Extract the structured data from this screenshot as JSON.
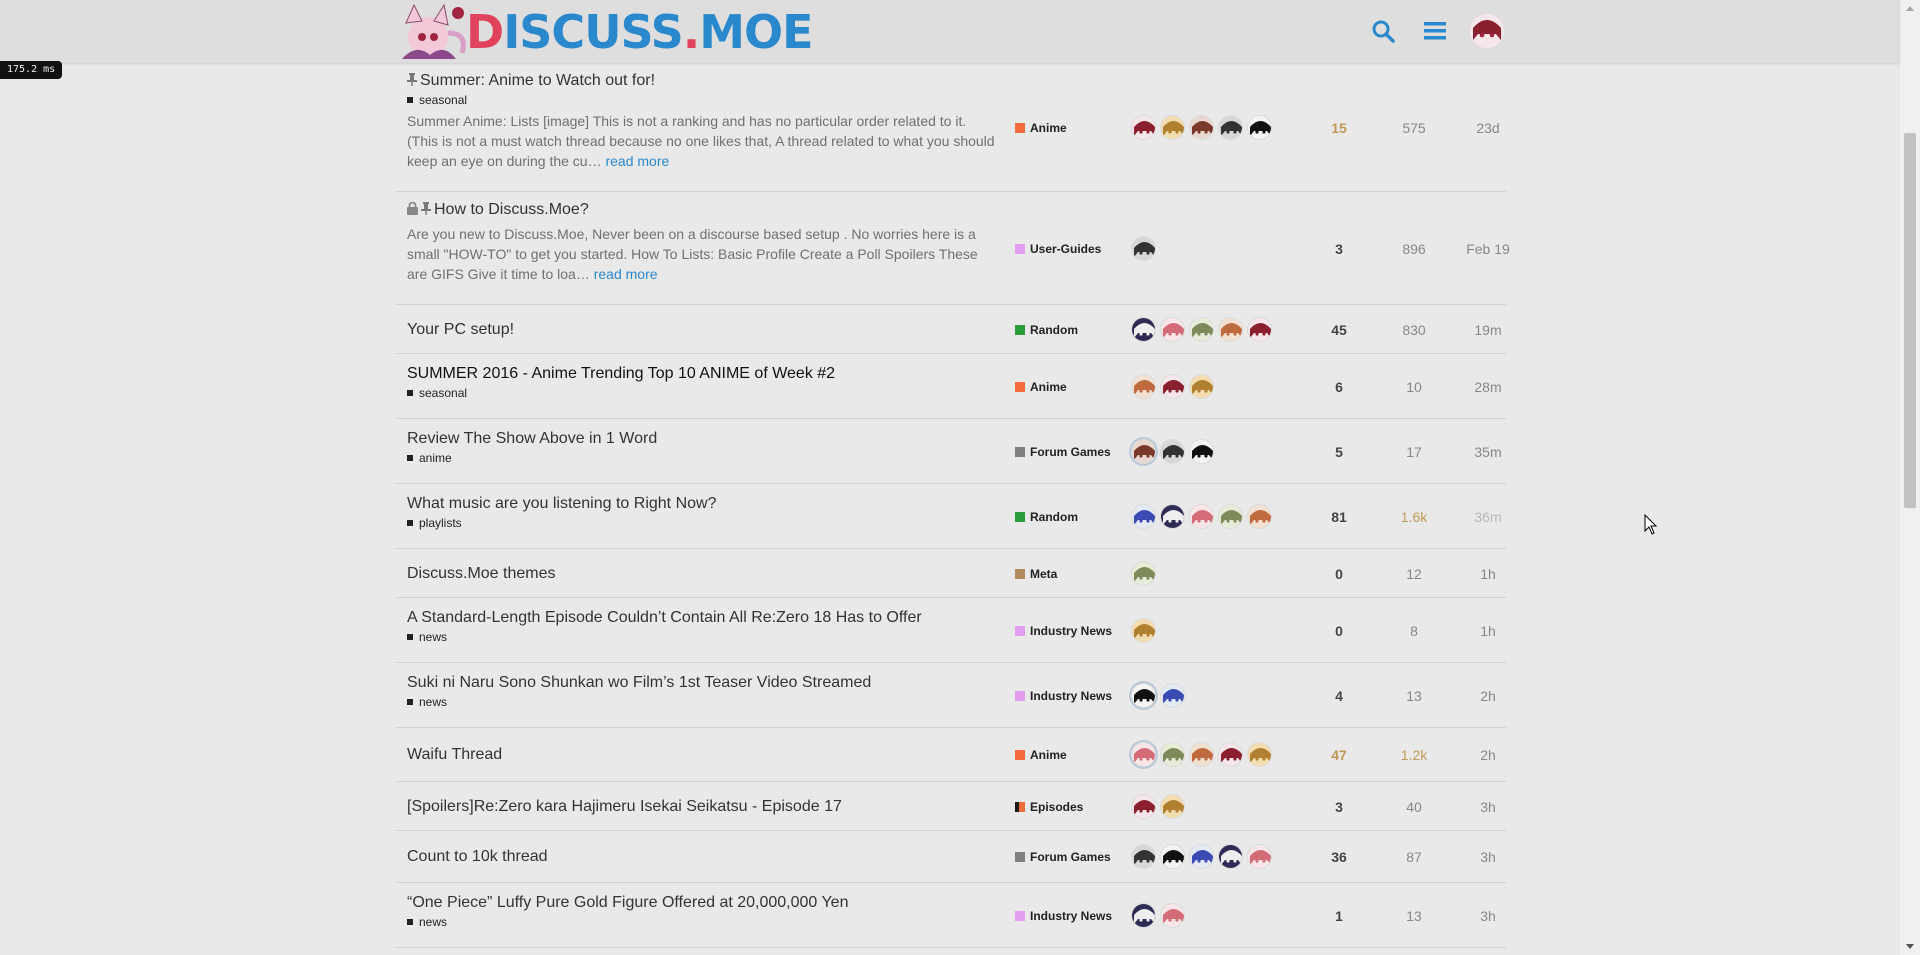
{
  "header": {
    "logo_text_d": "D",
    "logo_text_rest": "ISCUSS",
    "logo_text_dot": ".",
    "logo_text_moe": "MOE",
    "icons": [
      "search-icon",
      "hamburger-menu-icon",
      "user-avatar"
    ],
    "accent": "#2a88cc",
    "brand_red": "#e0435b"
  },
  "perf_badge": "175.2 ms",
  "topics": [
    {
      "title": "Summer: Anime to Watch out for!",
      "pinned": true,
      "locked": false,
      "tag": "seasonal",
      "excerpt": "Summer Anime: Lists [image] This is not a ranking and has no particular order related to it. (This is not a must watch thread because no one likes that, A thread related to what you should keep an eye on during the cu…",
      "read_more": "read more",
      "category": "Anime",
      "cat_color": "#f26b3a",
      "posters": 5,
      "replies": "15",
      "views": "575",
      "activity": "23d",
      "replies_hot": true
    },
    {
      "title": "How to Discuss.Moe?",
      "pinned": true,
      "locked": true,
      "tag": "",
      "excerpt": "Are you new to Discuss.Moe, Never been on a discourse based setup . No worries here is a small \"HOW-TO\" to get you started. How To Lists: Basic Profile Create a Poll Spoilers These are GIFS Give it time to loa…",
      "read_more": "read more",
      "category": "User-Guides",
      "cat_color": "#e49ef0",
      "posters": 1,
      "replies": "3",
      "views": "896",
      "activity": "Feb 19"
    },
    {
      "title": "Your PC setup!",
      "tag": "",
      "category": "Random",
      "cat_color": "#2a9d3a",
      "posters": 5,
      "replies": "45",
      "views": "830",
      "activity": "19m"
    },
    {
      "title": "SUMMER 2016 - Anime Trending Top 10 ANIME of Week #2",
      "unread": true,
      "tag": "seasonal",
      "category": "Anime",
      "cat_color": "#f26b3a",
      "posters": 3,
      "replies": "6",
      "views": "10",
      "activity": "28m"
    },
    {
      "title": "Review The Show Above in 1 Word",
      "tag": "anime",
      "category": "Forum Games",
      "cat_color": "#808080",
      "posters": 3,
      "replies": "5",
      "views": "17",
      "activity": "35m"
    },
    {
      "title": "What music are you listening to Right Now?",
      "tag": "playlists",
      "category": "Random",
      "cat_color": "#2a9d3a",
      "posters": 5,
      "replies": "81",
      "views": "1.6k",
      "activity": "36m",
      "views_hot": true,
      "activity_faded": true
    },
    {
      "title": "Discuss.Moe themes",
      "tag": "",
      "category": "Meta",
      "cat_color": "#b38a5e",
      "posters": 1,
      "replies": "0",
      "views": "12",
      "activity": "1h"
    },
    {
      "title": "A Standard-Length Episode Couldn’t Contain All Re:Zero 18 Has to Offer",
      "tag": "news",
      "category": "Industry News",
      "cat_color": "#e49ef0",
      "posters": 1,
      "replies": "0",
      "views": "8",
      "activity": "1h"
    },
    {
      "title": "Suki ni Naru Sono Shunkan wo Film’s 1st Teaser Video Streamed",
      "tag": "news",
      "category": "Industry News",
      "cat_color": "#e49ef0",
      "posters": 2,
      "replies": "4",
      "views": "13",
      "activity": "2h"
    },
    {
      "title": "Waifu Thread",
      "tag": "",
      "category": "Anime",
      "cat_color": "#f26b3a",
      "posters": 5,
      "replies": "47",
      "views": "1.2k",
      "activity": "2h",
      "replies_hot": true,
      "views_hot": true
    },
    {
      "title": "[Spoilers]Re:Zero kara Hajimeru Isekai Seikatsu - Episode 17",
      "tag": "",
      "category": "Episodes",
      "cat_color": "#f26b3a",
      "cat_split": "#1a1a1a",
      "posters": 2,
      "replies": "3",
      "views": "40",
      "activity": "3h"
    },
    {
      "title": "Count to 10k thread",
      "tag": "",
      "category": "Forum Games",
      "cat_color": "#808080",
      "posters": 5,
      "replies": "36",
      "views": "87",
      "activity": "3h"
    },
    {
      "title": "“One Piece” Luffy Pure Gold Figure Offered at 20,000,000 Yen",
      "tag": "news",
      "category": "Industry News",
      "cat_color": "#e49ef0",
      "posters": 2,
      "replies": "1",
      "views": "13",
      "activity": "3h"
    }
  ]
}
